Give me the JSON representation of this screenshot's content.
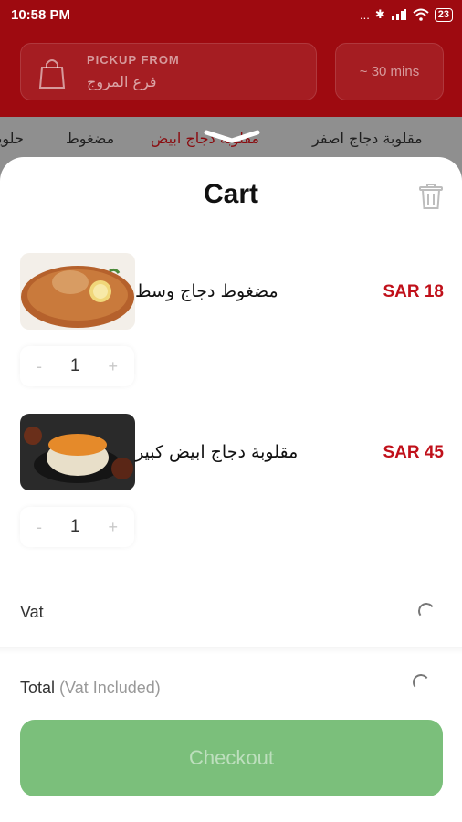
{
  "status_bar": {
    "time": "10:58 PM",
    "signal": "...",
    "bluetooth": "✱",
    "battery": "23"
  },
  "header": {
    "pickup_label": "PICKUP FROM",
    "pickup_branch": "فرع المروج",
    "eta": "~ 30 mins"
  },
  "tabs": [
    {
      "label": "مقلوبة دجاج اصفر"
    },
    {
      "label": "مقلوبة دجاج ابيض"
    },
    {
      "label": "مضغوط"
    },
    {
      "label": "حلويات"
    }
  ],
  "cart": {
    "title": "Cart",
    "items": [
      {
        "name": "مضغوط دجاج وسط",
        "price": "SAR 18",
        "quantity": "1",
        "minus": "-",
        "plus": "+"
      },
      {
        "name": "مقلوبة دجاج ابيض كبير",
        "price": "SAR 45",
        "quantity": "1",
        "minus": "-",
        "plus": "+"
      }
    ],
    "vat_label": "Vat",
    "total_label": "Total",
    "total_note": "(Vat Included)",
    "checkout_label": "Checkout"
  },
  "colors": {
    "brand_red": "#9e0a10",
    "price_red": "#c0101a",
    "checkout_green": "#7bbf7b"
  }
}
